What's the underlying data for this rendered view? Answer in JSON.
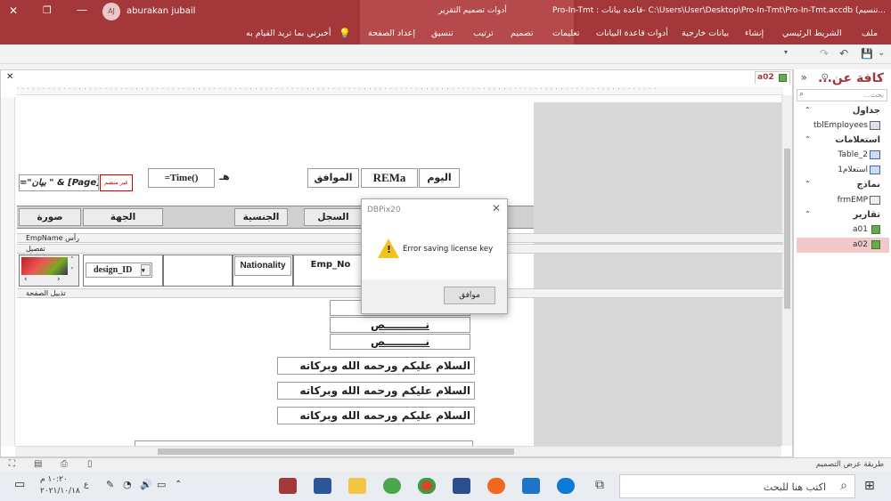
{
  "titlebar": {
    "title": "Pro-In-Tmt : قاعدة بيانات- C:\\Users\\User\\Desktop\\Pro-In-Tmt\\Pro-In-Tmt.accdb (تنسيم...",
    "context_title": "أدوات تصميم التقرير",
    "user_initials": "AJ",
    "user_name": "aburakan jubail"
  },
  "ribbon": {
    "tabs": [
      "ملف",
      "الشريط الرئيسي",
      "إنشاء",
      "بيانات خارجية",
      "أدوات قاعدة البيانات",
      "تعليمات",
      "تصميم",
      "ترتيب",
      "تنسيق",
      "إعداد الصفحة"
    ],
    "tellme": "أخبرني بما تريد القيام به"
  },
  "document_tab": {
    "name": "a02",
    "close": "×"
  },
  "report": {
    "header_controls": {
      "today": "اليوم",
      "rema": "REMa",
      "corresponding": "الموافق",
      "h": "هـ",
      "time": "=Time()",
      "unbound": "غير منضم",
      "page_expr": "=\"بيان \" & [Page]"
    },
    "column_headers": [
      "صورة",
      "الجهة",
      "الجنسية",
      "السجل"
    ],
    "sections": {
      "page_header": "رأس EmpName",
      "detail": "تفصيل",
      "page_footer": "تذييل الصفحة"
    },
    "detail_fields": {
      "design": "design_ID",
      "nationality": "Nationality",
      "emp_no": "Emp_No"
    },
    "footer_text": [
      "نـــــــــــص",
      "نـــــــــــص",
      "نـــــــــــص"
    ],
    "greeting": [
      "السلام عليكم ورحمه الله وبركاته",
      "السلام عليكم ورحمه الله وبركاته",
      "السلام عليكم ورحمه الله وبركاته"
    ]
  },
  "dialog": {
    "title": "DBPix20",
    "message": "Error saving license key",
    "ok": "موافق"
  },
  "nav": {
    "title": "كافة عن...",
    "search_placeholder": "بحث...",
    "groups": [
      {
        "name": "جداول",
        "items": [
          "tblEmployees"
        ]
      },
      {
        "name": "استعلامات",
        "items": [
          "Table_2",
          "استعلام1"
        ]
      },
      {
        "name": "نماذج",
        "items": [
          "frmEMP"
        ]
      },
      {
        "name": "تقارير",
        "items": [
          "a01",
          "a02"
        ]
      }
    ]
  },
  "statusbar": {
    "mode": "طريقة عرض التصميم"
  },
  "taskbar": {
    "search": "اكتب هنا للبحث",
    "time": "١٠:٢٠ م",
    "date": "٢٠٢١/١٠/١٨",
    "lang": "ع"
  },
  "colors": {
    "accent": "#a4373a",
    "selected": "#f4c7c8"
  }
}
